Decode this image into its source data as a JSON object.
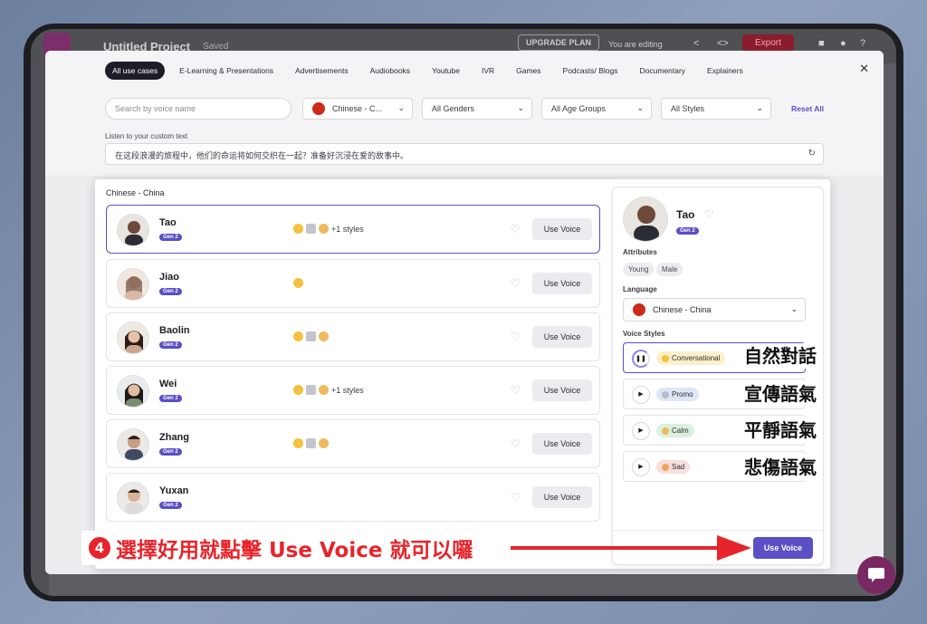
{
  "app": {
    "project_title": "Untitled Project",
    "saved": "Saved",
    "upgrade": "UPGRADE PLAN",
    "editing": "You are editing",
    "export": "Export"
  },
  "modal": {
    "categories": [
      "All use cases",
      "E-Learning & Presentations",
      "Advertisements",
      "Audiobooks",
      "Youtube",
      "IVR",
      "Games",
      "Podcasts/ Blogs",
      "Documentary",
      "Explainers"
    ],
    "search_placeholder": "Search by voice name",
    "language_filter": "Chinese - C...",
    "gender_filter": "All Genders",
    "age_filter": "All Age Groups",
    "style_filter": "All Styles",
    "reset": "Reset All",
    "listen_label": "Listen to your custom text",
    "listen_text": "在这段浪漫的旅程中，他们的命运将如何交织在一起？准备好沉浸在爱的故事中。"
  },
  "list": {
    "heading": "Chinese - China",
    "gen_label": "Gen 2",
    "use_label": "Use Voice",
    "voices": [
      {
        "name": "Tao",
        "extra": "+1 styles"
      },
      {
        "name": "Jiao",
        "extra": ""
      },
      {
        "name": "Baolin",
        "extra": ""
      },
      {
        "name": "Wei",
        "extra": "+1 styles"
      },
      {
        "name": "Zhang",
        "extra": ""
      },
      {
        "name": "Yuxan",
        "extra": ""
      }
    ]
  },
  "detail": {
    "name": "Tao",
    "gen": "Gen 2",
    "attributes_label": "Attributes",
    "attributes": [
      "Young",
      "Male"
    ],
    "language_label": "Language",
    "language": "Chinese - China",
    "styles_label": "Voice Styles",
    "styles": [
      {
        "name": "Conversational",
        "color": "#fdf0c9"
      },
      {
        "name": "Promo",
        "color": "#dde7f6"
      },
      {
        "name": "Calm",
        "color": "#d9f1dd"
      },
      {
        "name": "Sad",
        "color": "#f9dede"
      }
    ],
    "use_button": "Use Voice"
  },
  "annotations": {
    "style_labels": [
      "自然對話",
      "宣傳語氣",
      "平靜語氣",
      "悲傷語氣"
    ],
    "step_number": "4",
    "caption": "選擇好用就點擊 Use Voice 就可以囉"
  },
  "colors": {
    "accent": "#5a4fc4",
    "annotation_red": "#e8242b"
  }
}
